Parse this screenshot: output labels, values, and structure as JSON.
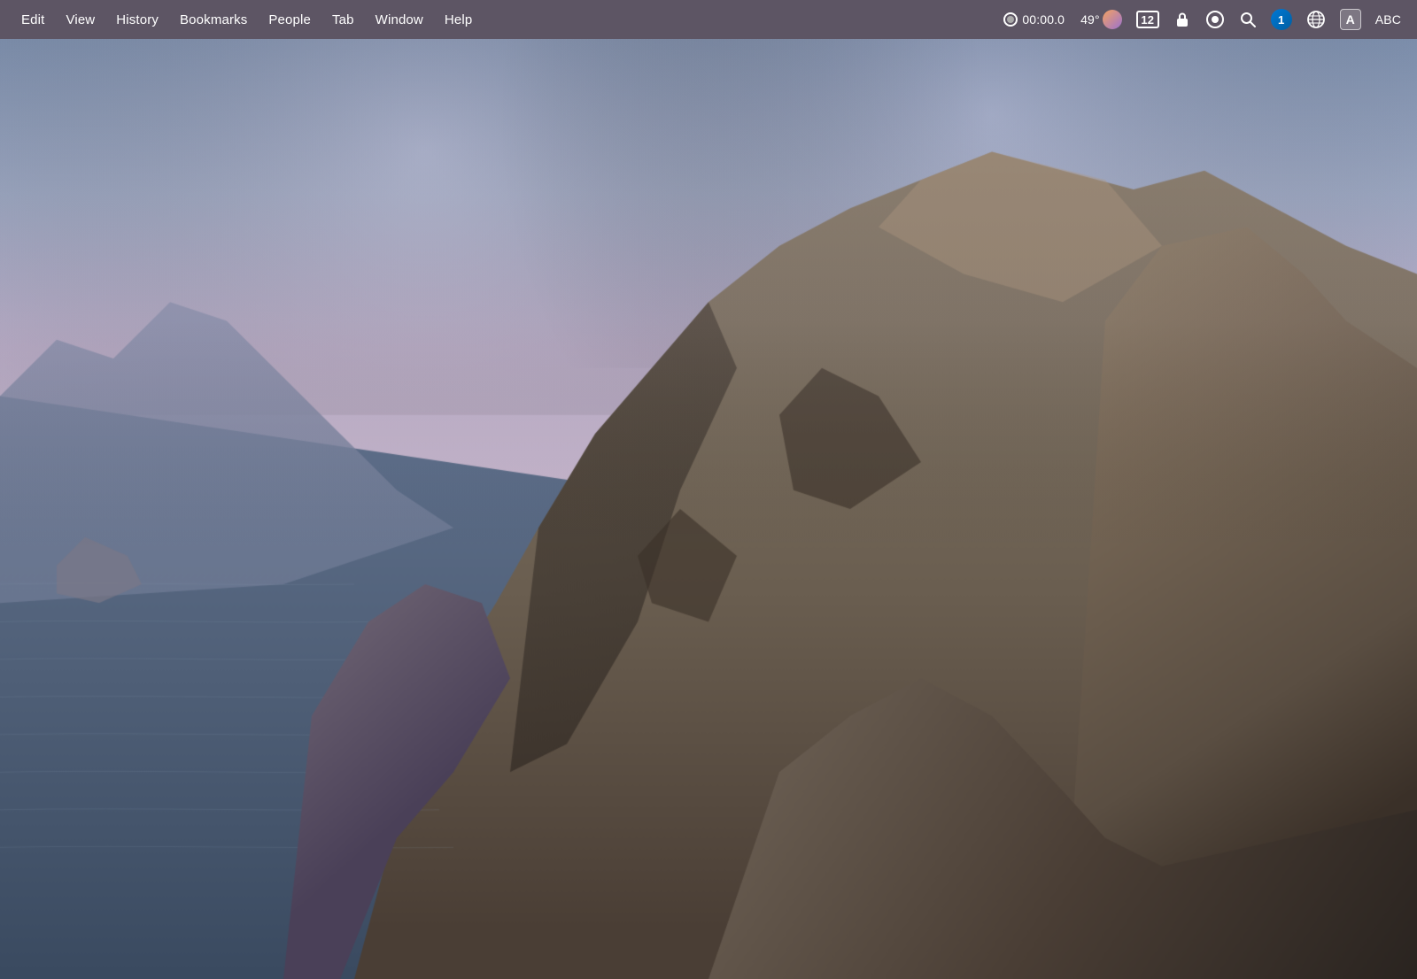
{
  "menubar": {
    "items": [
      {
        "id": "edit",
        "label": "Edit"
      },
      {
        "id": "view",
        "label": "View"
      },
      {
        "id": "history",
        "label": "History"
      },
      {
        "id": "bookmarks",
        "label": "Bookmarks"
      },
      {
        "id": "people",
        "label": "People"
      },
      {
        "id": "tab",
        "label": "Tab"
      },
      {
        "id": "window",
        "label": "Window"
      },
      {
        "id": "help",
        "label": "Help"
      }
    ],
    "status_items": [
      {
        "id": "record",
        "label": "00:00.0",
        "type": "record"
      },
      {
        "id": "weather",
        "label": "49°",
        "type": "weather"
      },
      {
        "id": "screen12",
        "label": "12",
        "type": "screen"
      },
      {
        "id": "screenlock",
        "label": "",
        "type": "screenlock"
      },
      {
        "id": "screencapture",
        "label": "",
        "type": "screencapture"
      },
      {
        "id": "search",
        "label": "",
        "type": "search"
      },
      {
        "id": "1password",
        "label": "",
        "type": "1password"
      },
      {
        "id": "safari",
        "label": "",
        "type": "safari"
      },
      {
        "id": "textinput",
        "label": "A",
        "type": "textinput"
      },
      {
        "id": "abc",
        "label": "ABC",
        "type": "abc"
      }
    ]
  },
  "background": {
    "description": "macOS Catalina wallpaper - coastal cliffs and mountain landscape at dusk",
    "sky_color_top": "#8a9bbf",
    "sky_color_mid": "#b8a8c4",
    "sky_color_bottom": "#c9b8cc",
    "water_color": "#6b7fa0",
    "mountain_color": "#7a6e6a"
  }
}
